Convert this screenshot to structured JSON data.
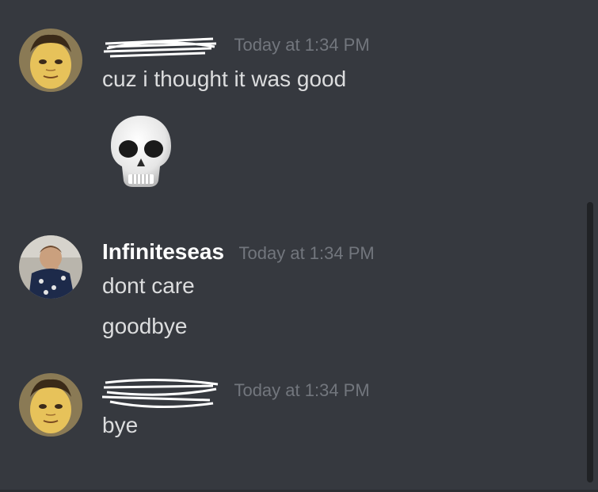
{
  "messages": [
    {
      "author": "",
      "author_redacted": true,
      "timestamp": "Today at 1:34 PM",
      "lines": [
        "cuz i thought it was good"
      ],
      "emoji": "skull-emoji"
    },
    {
      "author": "Infiniteseas",
      "author_redacted": false,
      "timestamp": "Today at 1:34 PM",
      "lines": [
        "dont care",
        "goodbye"
      ]
    },
    {
      "author": "",
      "author_redacted": true,
      "timestamp": "Today at 1:34 PM",
      "lines": [
        "bye"
      ]
    }
  ],
  "colors": {
    "background": "#36393f",
    "username": "#ffffff",
    "message_text": "#dcddde",
    "timestamp": "#72767d",
    "scrollbar": "#202225"
  }
}
